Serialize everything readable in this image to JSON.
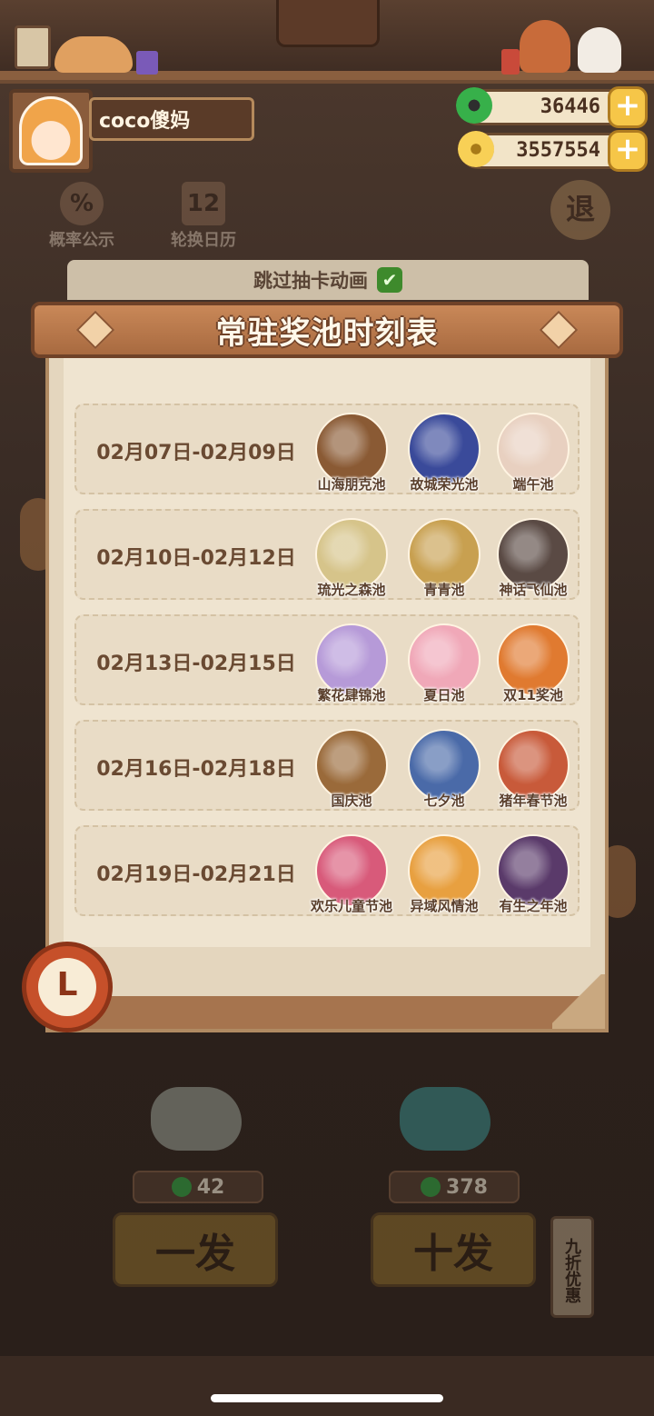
{
  "user": {
    "name": "coco傻妈"
  },
  "currency": {
    "jade": "36446",
    "coins": "3557554",
    "plus_symbol": "+"
  },
  "top_menu": {
    "probability_icon_glyph": "%",
    "probability_label": "概率公示",
    "calendar_icon_glyph": "12",
    "calendar_label": "轮换日历",
    "back_label": "退"
  },
  "skip_animation": {
    "label": "跳过抽卡动画",
    "checked_glyph": "✔"
  },
  "modal": {
    "title": "常驻奖池时刻表",
    "rows": [
      {
        "date": "02月07日-02月09日",
        "pools": [
          {
            "name": "山海朋克池",
            "color": "#8a5a34"
          },
          {
            "name": "故城荣光池",
            "color": "#3a4a9a"
          },
          {
            "name": "端午池",
            "color": "#e8d0c0"
          }
        ]
      },
      {
        "date": "02月10日-02月12日",
        "pools": [
          {
            "name": "琉光之森池",
            "color": "#d6c48a"
          },
          {
            "name": "青青池",
            "color": "#c8a050"
          },
          {
            "name": "神话飞仙池",
            "color": "#5a4a44"
          }
        ]
      },
      {
        "date": "02月13日-02月15日",
        "pools": [
          {
            "name": "繁花肆锦池",
            "color": "#b69ad8"
          },
          {
            "name": "夏日池",
            "color": "#f0a8b8"
          },
          {
            "name": "双11奖池",
            "color": "#e07a30"
          }
        ]
      },
      {
        "date": "02月16日-02月18日",
        "pools": [
          {
            "name": "国庆池",
            "color": "#9a6a3a"
          },
          {
            "name": "七夕池",
            "color": "#4a6aa8"
          },
          {
            "name": "猪年春节池",
            "color": "#c85a3a"
          }
        ]
      },
      {
        "date": "02月19日-02月21日",
        "pools": [
          {
            "name": "欢乐儿童节池",
            "color": "#d85a7a"
          },
          {
            "name": "异域风情池",
            "color": "#e8a040"
          },
          {
            "name": "有生之年池",
            "color": "#5a3a6a"
          }
        ]
      }
    ]
  },
  "bottom": {
    "single_cost": "42",
    "ten_cost": "378",
    "single_draw_label": "一发",
    "ten_draw_label": "十发",
    "discount_label": "九折优惠"
  },
  "clock_glyph": "L"
}
